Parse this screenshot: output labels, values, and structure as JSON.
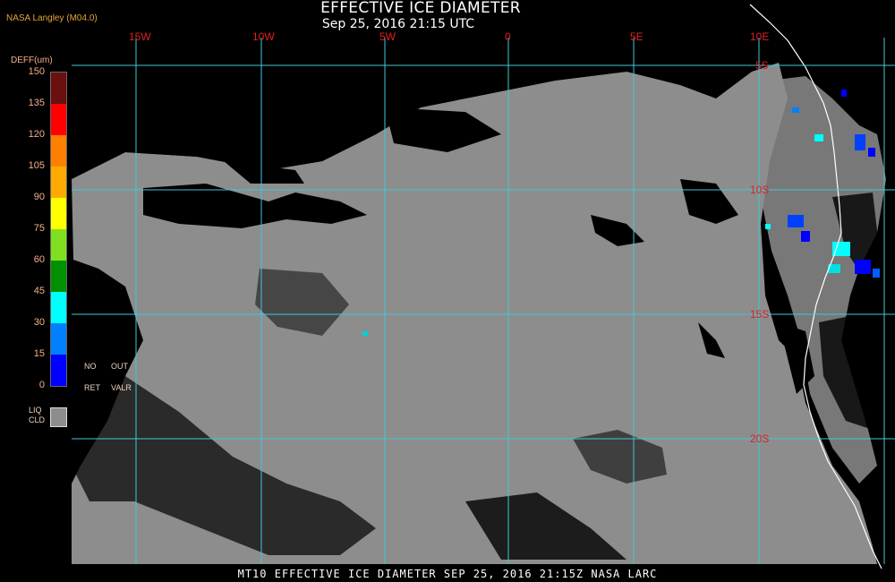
{
  "header": {
    "title": "EFFECTIVE ICE DIAMETER",
    "subtitle": "Sep 25, 2016 21:15 UTC",
    "source": "NASA Langley (M04.0)"
  },
  "legend": {
    "title": "DEFF(um)",
    "ticks": [
      "150",
      "135",
      "120",
      "105",
      "90",
      "75",
      "60",
      "45",
      "30",
      "15",
      "0"
    ],
    "colors": [
      "#6b1010",
      "#ff0000",
      "#ff8000",
      "#ffaa00",
      "#ffff00",
      "#80e020",
      "#009000",
      "#00ffff",
      "#0080ff",
      "#0000ff",
      "#a020ff"
    ],
    "no_ret": [
      "NO",
      "RET"
    ],
    "out_valr": [
      "OUT",
      "VALR"
    ],
    "liq_cld": [
      "LIQ",
      "CLD"
    ]
  },
  "grid": {
    "lon_labels": [
      "15W",
      "10W",
      "5W",
      "0",
      "5E",
      "10E"
    ],
    "lat_labels": [
      "5S",
      "10S",
      "15S",
      "20S"
    ]
  },
  "footer": "MT10  EFFECTIVE ICE DIAMETER  SEP 25, 2016 21:15Z  NASA LARC",
  "colors": {
    "liquid_cloud": "#8d8d8d",
    "grid": "#40c8d8",
    "coastline": "#ffffff"
  }
}
